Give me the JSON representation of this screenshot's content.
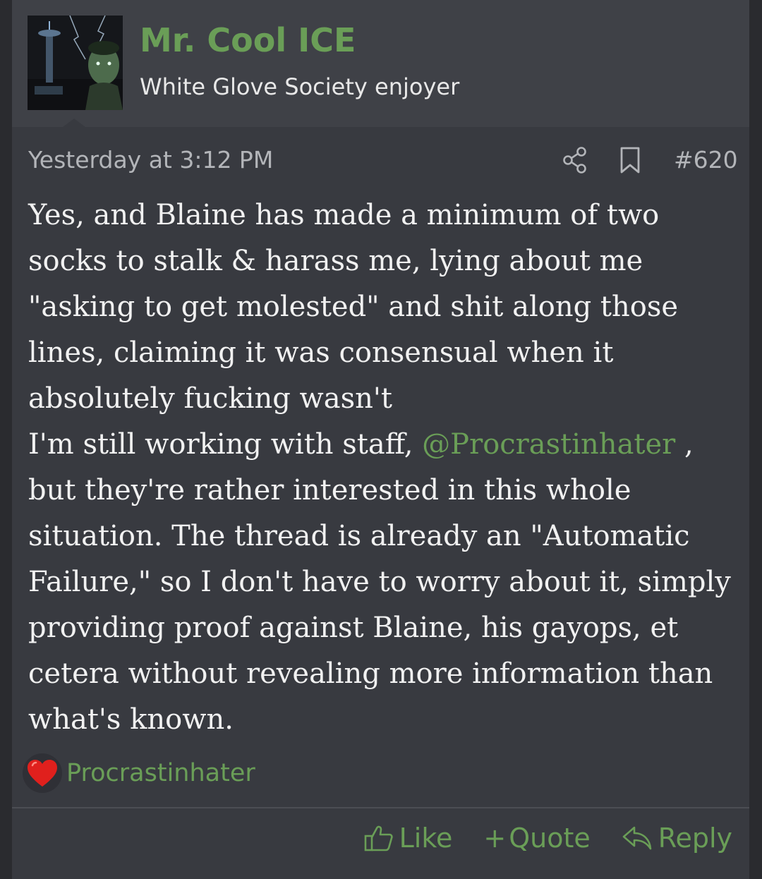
{
  "author": {
    "name": "Mr. Cool ICE",
    "title": "White Glove Society enjoyer"
  },
  "meta": {
    "date": "Yesterday at 3:12 PM",
    "post_number": "#620"
  },
  "message": {
    "paragraph1": "Yes, and Blaine has made a minimum of two socks to stalk & harass me, lying about me \"asking to get molested\" and shit along those lines, claiming it was consensual when it absolutely fucking wasn't",
    "paragraph2_before": "I'm still working with staff, ",
    "mention": "@Procrastinhater",
    "paragraph2_after": " , but they're rather interested in this whole situation. The thread is already an \"Automatic Failure,\" so I don't have to worry about it, simply providing proof against Blaine, his gayops, et cetera without revealing more information than what's known."
  },
  "reactions": {
    "icon": "heart-icon",
    "users": "Procrastinhater"
  },
  "actions": {
    "like": "Like",
    "quote": "Quote",
    "quote_prefix": "+",
    "reply": "Reply"
  },
  "colors": {
    "accent": "#6a9e57",
    "background": "#383a40",
    "header": "#3f4147",
    "text": "#f1f1f1",
    "muted": "#b3b5b9",
    "heart": "#e0201d"
  }
}
